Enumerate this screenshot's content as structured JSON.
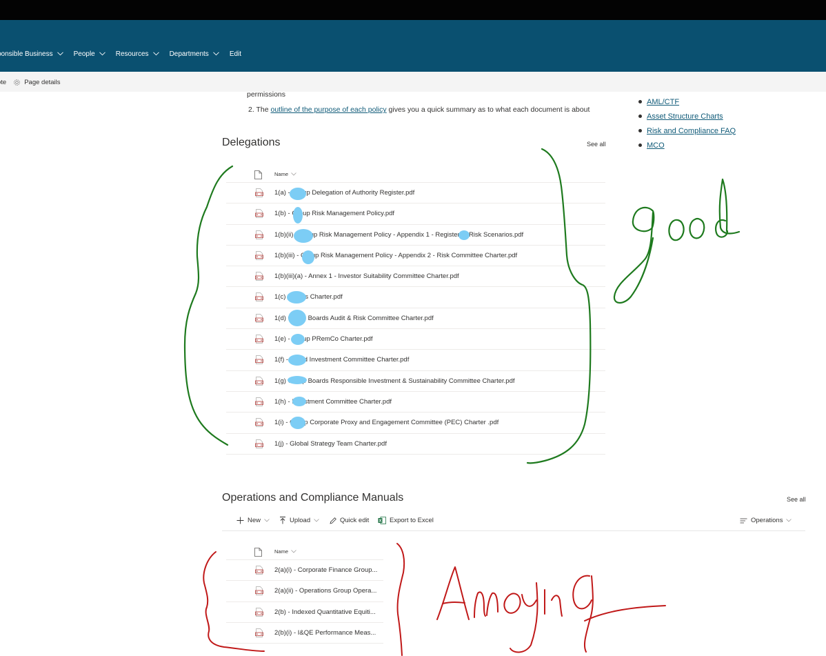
{
  "nav": {
    "items": [
      {
        "label": "sponsible Business",
        "has_dropdown": true
      },
      {
        "label": "People",
        "has_dropdown": true
      },
      {
        "label": "Resources",
        "has_dropdown": true
      },
      {
        "label": "Departments",
        "has_dropdown": true
      },
      {
        "label": "Edit",
        "has_dropdown": false
      }
    ]
  },
  "command_bar": {
    "partial_label": "ote",
    "page_details_label": "Page details"
  },
  "intro": {
    "line1": "permissions",
    "line2_prefix": "2. The ",
    "line2_link": "outline of the purpose of each policy",
    "line2_suffix": " gives you a quick summary as to what each document is about"
  },
  "quick_links": [
    {
      "label": "AML/CTF"
    },
    {
      "label": "Asset Structure Charts"
    },
    {
      "label": "Risk and Compliance FAQ"
    },
    {
      "label": "MCO"
    }
  ],
  "delegations": {
    "title": "Delegations",
    "see_all": "See all",
    "column_header": "Name",
    "files": [
      {
        "name": "1(a) -        Group Delegation of Authority Register.pdf"
      },
      {
        "name": "1(b) -      Group Risk Management Policy.pdf"
      },
      {
        "name": "1(b)(ii) -         Group Risk Management Policy - Appendix 1 -        Register of Risk Scenarios.pdf"
      },
      {
        "name": "1(b)(iii) -       Group Risk Management Policy - Appendix 2 - Risk Committee Charter.pdf"
      },
      {
        "name": "1(b)(iii)(a) - Annex 1 - Investor Suitability Committee Charter.pdf"
      },
      {
        "name": "1(c)           Boards Charter.pdf"
      },
      {
        "name": "1(d)           Group Boards Audit & Risk Committee Charter.pdf"
      },
      {
        "name": "1(e) -        Group PRemCo Charter.pdf"
      },
      {
        "name": "1(f) -         Board Investment Committee Charter.pdf"
      },
      {
        "name": "1(g)           Group Boards Responsible Investment & Sustainability Committee Charter.pdf"
      },
      {
        "name": "1(h) -        Investment Committee Charter.pdf"
      },
      {
        "name": "1(i) -         Group Corporate Proxy and Engagement Committee (PEC) Charter .pdf"
      },
      {
        "name": "1(j) - Global Strategy Team Charter.pdf"
      }
    ]
  },
  "operations": {
    "title": "Operations and Compliance Manuals",
    "see_all": "See all",
    "toolbar": {
      "new_label": "New",
      "upload_label": "Upload",
      "quick_edit_label": "Quick edit",
      "export_label": "Export to Excel",
      "view_label": "Operations"
    },
    "column_header": "Name",
    "files": [
      {
        "name": "2(a)(i) - Corporate Finance Group..."
      },
      {
        "name": "2(a)(ii) - Operations Group Opera..."
      },
      {
        "name": "2(b) - Indexed Quantitative Equiti..."
      },
      {
        "name": "2(b)(i) - I&QE Performance Meas..."
      }
    ]
  },
  "annotations": {
    "good_label": "good",
    "good_color": "#1e7a1e",
    "annoying_label": "Annoying",
    "annoying_color": "#c01818",
    "redaction_color": "#7ccdf5"
  },
  "colors": {
    "nav_bg": "#0a5070",
    "topbar_bg": "#030303",
    "link": "#0f5a78",
    "pdf_icon": "#c0504d"
  }
}
